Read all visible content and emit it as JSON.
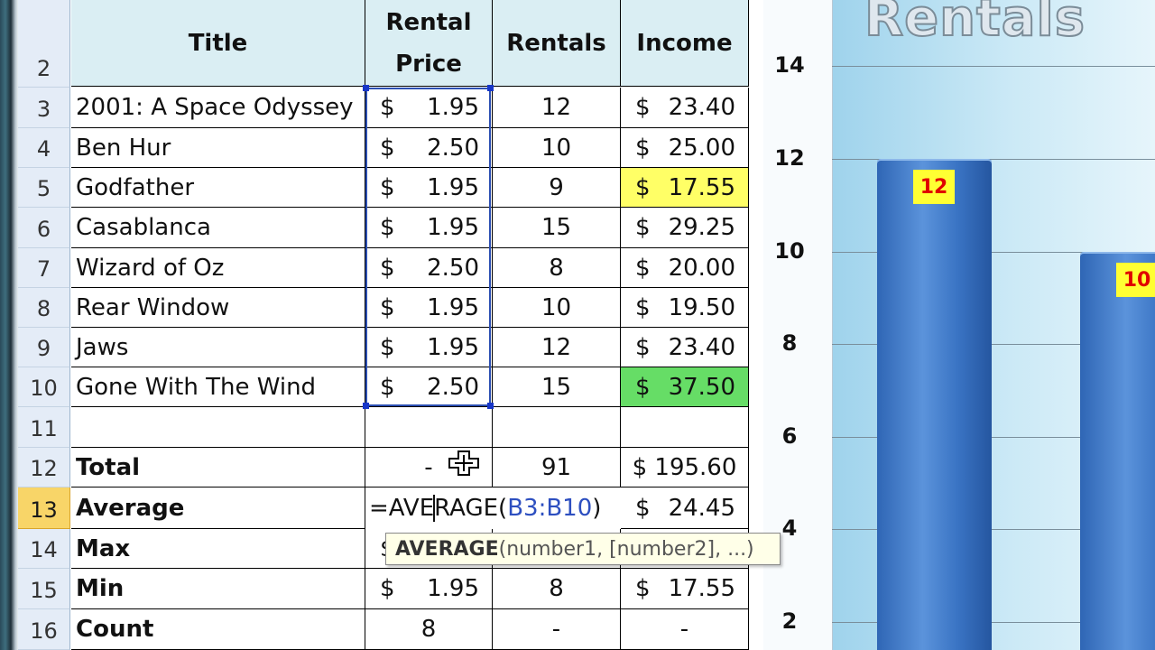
{
  "sheet": {
    "row_numbers": [
      "2",
      "3",
      "4",
      "5",
      "6",
      "7",
      "8",
      "9",
      "10",
      "11",
      "12",
      "13",
      "14",
      "15",
      "16"
    ],
    "active_row": "13",
    "headers": {
      "title": "Title",
      "rental_price_line1": "Rental",
      "rental_price_line2": "Price",
      "rentals": "Rentals",
      "income": "Income"
    },
    "currency": "$",
    "movies": [
      {
        "title": "2001: A Space Odyssey",
        "price": "1.95",
        "rentals": "12",
        "income": "23.40"
      },
      {
        "title": "Ben Hur",
        "price": "2.50",
        "rentals": "10",
        "income": "25.00"
      },
      {
        "title": "Godfather",
        "price": "1.95",
        "rentals": "9",
        "income": "17.55"
      },
      {
        "title": "Casablanca",
        "price": "1.95",
        "rentals": "15",
        "income": "29.25"
      },
      {
        "title": "Wizard of Oz",
        "price": "2.50",
        "rentals": "8",
        "income": "20.00"
      },
      {
        "title": "Rear Window",
        "price": "1.95",
        "rentals": "10",
        "income": "19.50"
      },
      {
        "title": "Jaws",
        "price": "1.95",
        "rentals": "12",
        "income": "23.40"
      },
      {
        "title": "Gone With The Wind",
        "price": "2.50",
        "rentals": "15",
        "income": "37.50"
      }
    ],
    "highlight_colors": {
      "min_income": "#ffff66",
      "max_income": "#66dd66"
    },
    "summary": {
      "total": {
        "label": "Total",
        "price": "-",
        "rentals": "91",
        "income": "$ 195.60"
      },
      "average": {
        "label": "Average",
        "income": "24.45"
      },
      "max": {
        "label": "Max",
        "price_partial": "$"
      },
      "min": {
        "label": "Min",
        "price": "1.95",
        "rentals": "8",
        "income": "17.55"
      },
      "count": {
        "label": "Count",
        "price": "8",
        "rentals": "-",
        "income": "-"
      }
    }
  },
  "formula_edit": {
    "prefix": "=AVE",
    "suffix": "RAGE(",
    "range": "B3:B10",
    "close": ")"
  },
  "tooltip": {
    "function_name": "AVERAGE",
    "args": "(number1, [number2], ...)"
  },
  "chart": {
    "title_partial": "Rentals"
  },
  "chart_data": {
    "type": "bar",
    "title": "Rentals",
    "categories": [
      "2001: A Space Odyssey",
      "Ben Hur"
    ],
    "values": [
      12,
      10
    ],
    "data_labels": [
      "12",
      "10"
    ],
    "yticks": [
      "14",
      "12",
      "10",
      "8",
      "6",
      "4",
      "2"
    ],
    "ylim_visible": [
      1.4,
      14.6
    ]
  }
}
